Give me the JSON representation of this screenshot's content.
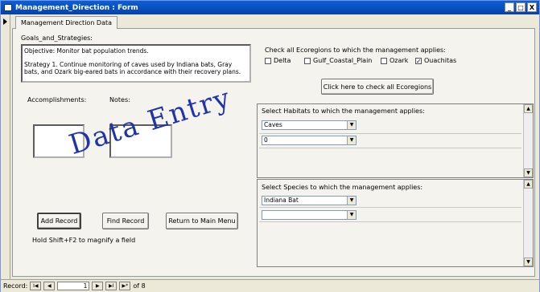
{
  "window": {
    "title": "Management_Direction : Form",
    "min": "_",
    "max": "□",
    "close": "X"
  },
  "tab": {
    "label": "Management Direction Data"
  },
  "goals": {
    "label": "Goals_and_Strategies:",
    "objective": "Objective: Monitor bat population trends.",
    "strategy": "Strategy 1.  Continue monitoring of caves used by Indiana bats, Gray bats, and Ozark big-eared bats in accordance with their recovery plans."
  },
  "accomplishments": {
    "label": "Accomplishments:",
    "value": ""
  },
  "notes": {
    "label": "Notes:",
    "value": ""
  },
  "ecoregions": {
    "label": "Check all Ecoregions to which the management applies:",
    "items": [
      {
        "label": "Delta",
        "checked": false,
        "mark": ""
      },
      {
        "label": "Gulf_Coastal_Plain",
        "checked": false,
        "mark": ""
      },
      {
        "label": "Ozark",
        "checked": false,
        "mark": ""
      },
      {
        "label": "Ouachitas",
        "checked": true,
        "mark": "✓"
      }
    ],
    "check_all_button": "Click here to check all Ecoregions"
  },
  "habitats": {
    "label": "Select Habitats to which the management applies:",
    "rows": [
      "Caves",
      "0"
    ]
  },
  "species": {
    "label": "Select Species to which the management applies:",
    "rows": [
      "Indiana Bat",
      ""
    ]
  },
  "buttons": {
    "add": "Add Record",
    "find": "Find Record",
    "main_menu": "Return to Main Menu"
  },
  "hint": "Hold Shift+F2 to magnify a field",
  "watermark": "Data Entry",
  "navigator": {
    "label": "Record:",
    "first": "I◀",
    "prev": "◀",
    "current": "1",
    "next": "▶",
    "last": "▶I",
    "new": "▶*",
    "of_text": "of 8"
  }
}
